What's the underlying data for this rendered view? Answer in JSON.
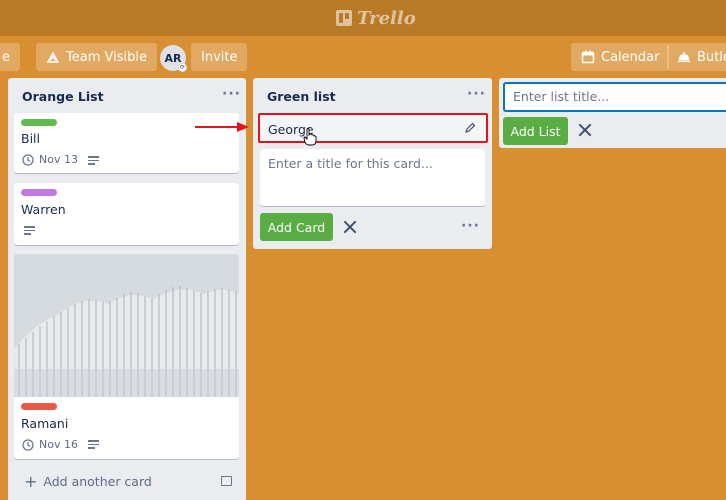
{
  "app": {
    "name": "Trello"
  },
  "board_header": {
    "left_button_partial": "e",
    "visibility_button": "Team Visible",
    "member_avatar": "AR",
    "invite_button": "Invite",
    "calendar_button": "Calendar",
    "butler_button": "Butler"
  },
  "lists": [
    {
      "title": "Orange List",
      "menu_icon": "more-horizontal-icon",
      "cards": [
        {
          "label_color": "#61bd4f",
          "title": "Bill",
          "due_date": "Nov 13",
          "has_description": true
        },
        {
          "label_color": "#c377e0",
          "title": "Warren",
          "has_description": true
        },
        {
          "cover": "architecture-photo",
          "label_color": "#eb5a46",
          "title": "Ramani",
          "due_date": "Nov 16",
          "has_description": true
        }
      ],
      "add_card_label": "Add another card"
    },
    {
      "title": "Green list",
      "menu_icon": "more-horizontal-icon",
      "editing_card": {
        "title": "George"
      },
      "composer": {
        "placeholder": "Enter a title for this card...",
        "add_button": "Add Card"
      }
    }
  ],
  "add_list": {
    "placeholder": "Enter list title...",
    "add_button": "Add List"
  },
  "annotation": {
    "arrow_color": "#e0161c",
    "highlight_color": "#e0161c"
  }
}
